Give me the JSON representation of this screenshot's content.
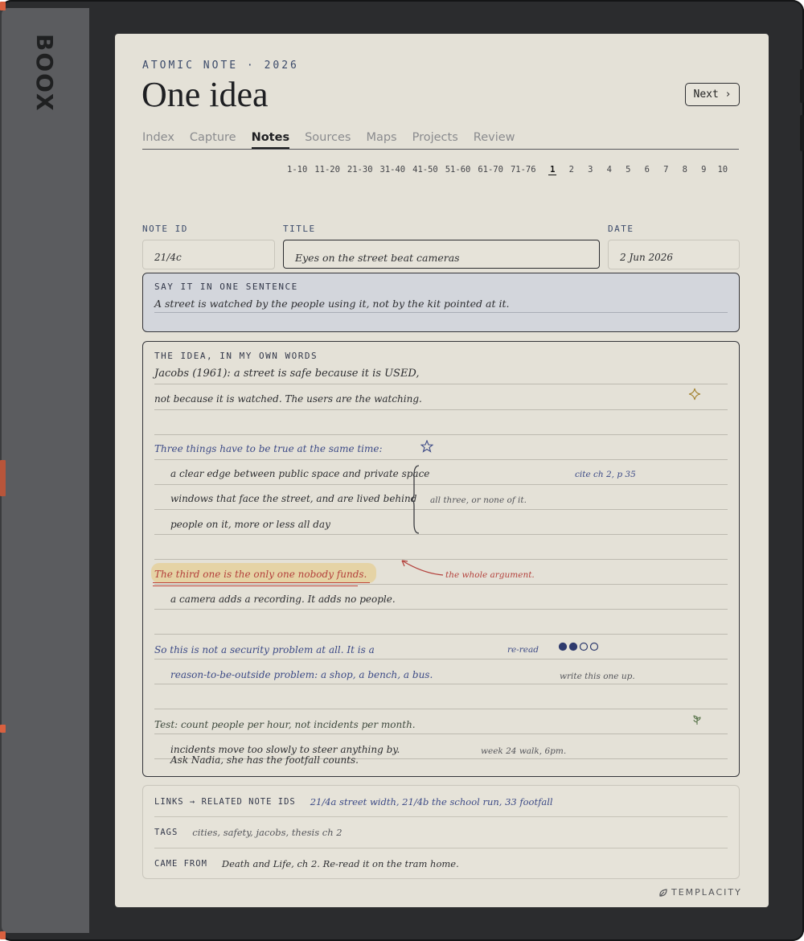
{
  "device": {
    "brand": "BOOX"
  },
  "header": {
    "kicker": "ATOMIC NOTE · 2026",
    "title": "One idea",
    "next_label": "Next ›"
  },
  "tabs": [
    {
      "label": "Index",
      "active": false
    },
    {
      "label": "Capture",
      "active": false
    },
    {
      "label": "Notes",
      "active": true
    },
    {
      "label": "Sources",
      "active": false
    },
    {
      "label": "Maps",
      "active": false
    },
    {
      "label": "Projects",
      "active": false
    },
    {
      "label": "Review",
      "active": false
    }
  ],
  "pager": {
    "ranges": [
      "1-10",
      "11-20",
      "21-30",
      "31-40",
      "41-50",
      "51-60",
      "61-70",
      "71-76"
    ],
    "pages": [
      "1",
      "2",
      "3",
      "4",
      "5",
      "6",
      "7",
      "8",
      "9",
      "10"
    ],
    "current": "1"
  },
  "fields": {
    "note_id": {
      "label": "NOTE ID",
      "value": "21/4c"
    },
    "title": {
      "label": "TITLE",
      "value": "Eyes on the street beat cameras"
    },
    "date": {
      "label": "DATE",
      "value": "2 Jun 2026"
    }
  },
  "sentence": {
    "label": "SAY IT IN ONE SENTENCE",
    "value": "A street is watched by the people using it, not by the kit pointed at it."
  },
  "idea": {
    "label": "THE IDEA, IN MY OWN WORDS",
    "l1": "Jacobs (1961): a street is safe because it is USED,",
    "l2": "not because it is watched. The users are the watching.",
    "l3": "Three things have to be true at the same time:",
    "l4": "a clear edge between public space and private space",
    "l5": "windows that face the street, and are lived behind",
    "l6": "people on it, more or less all day",
    "bracket_note": "all three, or none of it.",
    "cite_note": "cite ch 2, p 35",
    "l7": "The third one is the only one nobody funds.",
    "arrow_note": "the whole argument.",
    "l8": "a camera adds a recording. It adds no people.",
    "l9": "So this is not a security problem at all. It is a",
    "reread_note": "re-read",
    "rating": 2,
    "rating_max": 4,
    "l10": "reason-to-be-outside problem: a shop, a bench, a bus.",
    "write_note": "write this one up.",
    "l11": "Test: count people per hour, not incidents per month.",
    "l12": "incidents move too slowly to steer anything by.",
    "l13": "Ask Nadia, she has the footfall counts.",
    "walk_note": "week 24 walk, 6pm."
  },
  "links": {
    "links_label": "LINKS → RELATED NOTE IDS",
    "links_value": "21/4a street width, 21/4b the school run, 33 footfall",
    "tags_label": "TAGS",
    "tags_value": "cities, safety, jacobs, thesis ch 2",
    "from_label": "CAME FROM",
    "from_value": "Death and Life, ch 2. Re-read it on the tram home."
  },
  "footer": {
    "logo": "TEMPLACITY"
  },
  "colors": {
    "accent_blue": "#3c4a86",
    "highlight": "#e5d3a5",
    "underline_red": "#c0473d",
    "screen": "#e4e1d7",
    "bezel": "#2b2c2e",
    "marker": "#d9603f"
  }
}
